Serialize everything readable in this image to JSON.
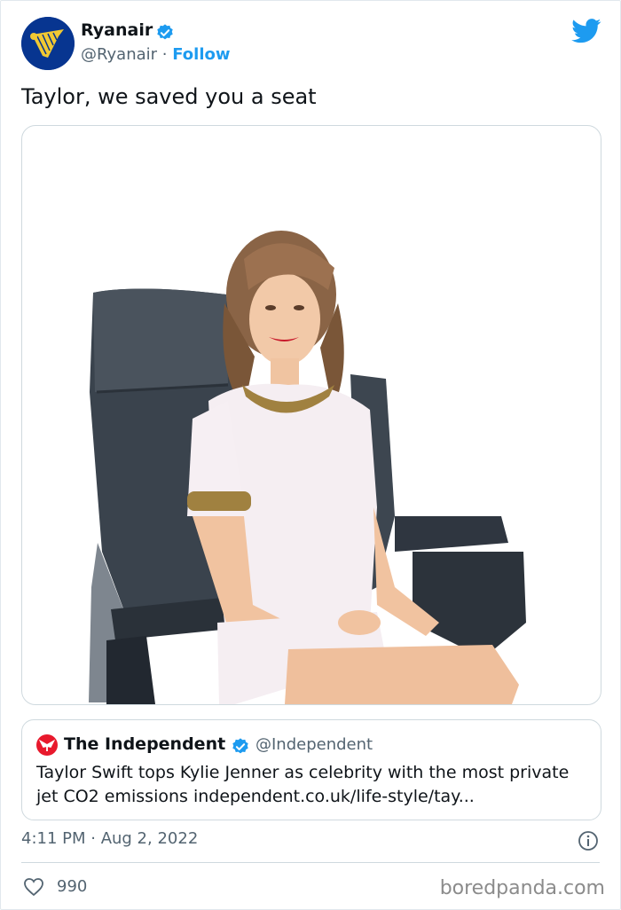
{
  "author": {
    "name": "Ryanair",
    "handle": "@Ryanair",
    "separator": " · ",
    "follow_label": "Follow"
  },
  "tweet": {
    "text": "Taylor, we saved you a seat",
    "timestamp": "4:11 PM · Aug 2, 2022",
    "likes": "990"
  },
  "quote": {
    "name": "The Independent",
    "handle": "@Independent",
    "text": "Taylor Swift tops Kylie Jenner as celebrity with the most private jet CO2 emissions independent.co.uk/life-style/tay..."
  },
  "watermark": "boredpanda.com",
  "colors": {
    "accent": "#1d9bf0",
    "text": "#0f1419",
    "muted": "#536471",
    "ryanair_blue": "#073590",
    "ryanair_yellow": "#f1c933",
    "independent_red": "#e8192c"
  },
  "icons": [
    "ryanair-harp-logo",
    "verified-badge-icon",
    "twitter-bird-icon",
    "independent-eagle-icon",
    "info-icon",
    "heart-icon"
  ]
}
